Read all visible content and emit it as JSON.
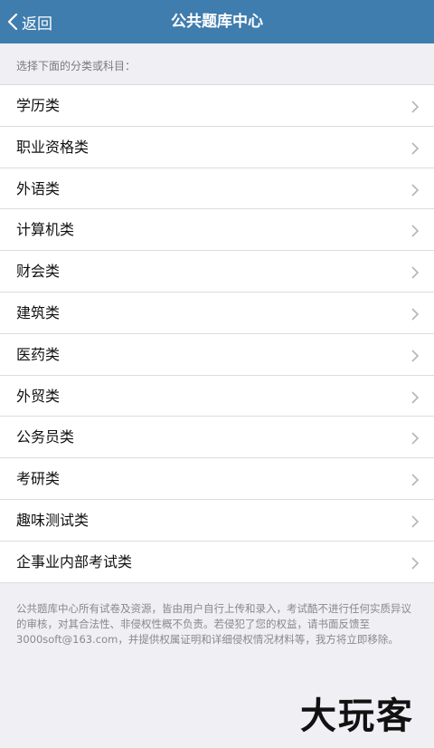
{
  "header": {
    "back_label": "返回",
    "title": "公共题库中心"
  },
  "hint": "选择下面的分类或科目：",
  "categories": [
    {
      "label": "学历类"
    },
    {
      "label": "职业资格类"
    },
    {
      "label": "外语类"
    },
    {
      "label": "计算机类"
    },
    {
      "label": "财会类"
    },
    {
      "label": "建筑类"
    },
    {
      "label": "医药类"
    },
    {
      "label": "外贸类"
    },
    {
      "label": "公务员类"
    },
    {
      "label": "考研类"
    },
    {
      "label": "趣味测试类"
    },
    {
      "label": "企事业内部考试类"
    }
  ],
  "footer": "公共题库中心所有试卷及资源，皆由用户自行上传和录入，考试酷不进行任何实质异议的审核，对其合法性、非侵权性概不负责。若侵犯了您的权益，请书面反馈至3000soft@163.com，并提供权属证明和详细侵权情况材料等，我方将立即移除。",
  "watermark": "大玩客",
  "colors": {
    "navbar": "#3f7dae",
    "background": "#efeff4"
  }
}
